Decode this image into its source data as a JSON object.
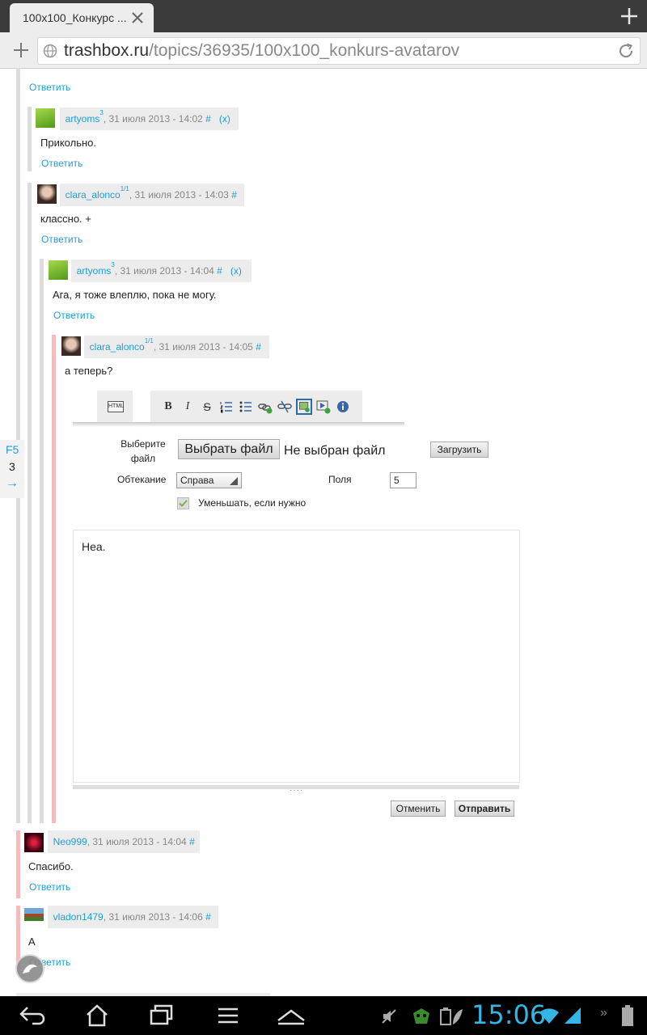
{
  "browser": {
    "tab_title": "100x100_Конкурс ...",
    "url_domain": "trashbox.ru",
    "url_path": "/topics/36935/100x100_konkurs-avatarov"
  },
  "top_reply": "Ответить",
  "comments": [
    {
      "user": "artyoms",
      "sup": "3",
      "date": ", 31 июля 2013 - 14:02",
      "hash": "#",
      "del": "(x)",
      "text": "Прикольно.",
      "reply": "Ответить"
    },
    {
      "user": "clara_alonco",
      "sup": "1/1",
      "date": ", 31 июля 2013 - 14:03",
      "hash": "#",
      "text": "классно. +",
      "reply": "Ответить"
    },
    {
      "user": "artyoms",
      "sup": "3",
      "date": ", 31 июля 2013 - 14:04",
      "hash": "#",
      "del": "(x)",
      "text": "Ага, я тоже влеплю, пока не могу.",
      "reply": "Ответить"
    },
    {
      "user": "clara_alonco",
      "sup": "1/1",
      "date": ", 31 июля 2013 - 14:05",
      "hash": "#",
      "text": "а теперь?"
    },
    {
      "user": "Neo999",
      "date": ", 31 июля 2013 - 14:04",
      "hash": "#",
      "text": "Спасибо.",
      "reply": "Ответить"
    },
    {
      "user": "vladon1479",
      "date": ", 31 июля 2013 - 14:06",
      "hash": "#",
      "text": "А",
      "reply": "Ответить"
    }
  ],
  "editor": {
    "html_btn": "HTML",
    "choose_file_label": "Выберите файл",
    "choose_file_btn": "Выбрать файл",
    "no_file": "Не выбран файл",
    "upload_btn": "Загрузить",
    "wrap_label": "Обтекание",
    "wrap_value": "Справа",
    "margin_label": "Поля",
    "margin_value": "5",
    "shrink_label": "Уменьшать, если нужно",
    "text": "Неа.",
    "cancel_btn": "Отменить",
    "submit_btn": "Отправить"
  },
  "side_counter": {
    "label": "F5",
    "count": "3",
    "arrow": "→"
  },
  "status": {
    "time": "15:06"
  }
}
